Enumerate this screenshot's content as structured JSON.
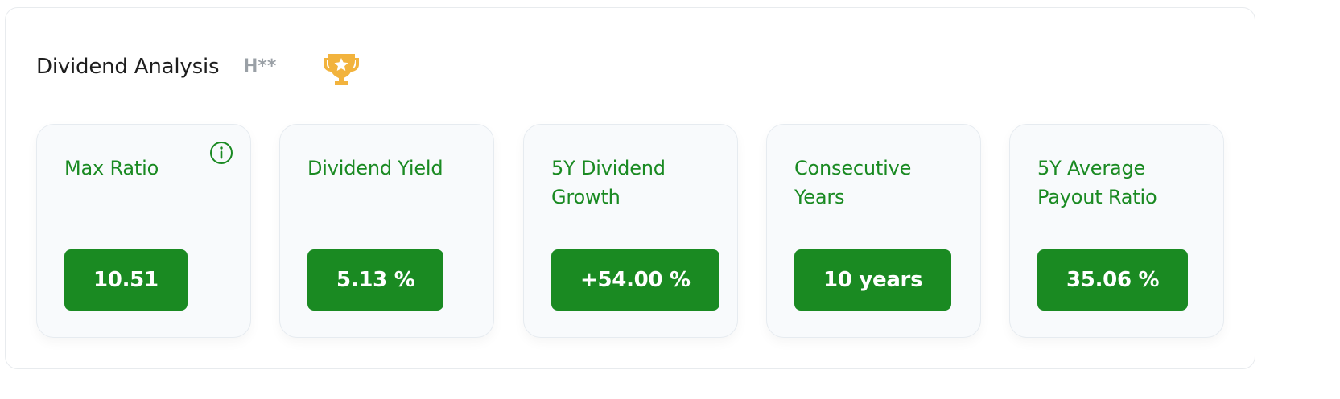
{
  "header": {
    "title": "Dividend Analysis",
    "ticker": "H**",
    "icon": "trophy-icon"
  },
  "cards": [
    {
      "label": "Max Ratio",
      "value": "10.51",
      "info_icon": "info-icon"
    },
    {
      "label": "Dividend Yield",
      "value": "5.13 %"
    },
    {
      "label": "5Y Dividend Growth",
      "value": "+54.00 %"
    },
    {
      "label": "Consecutive Years",
      "value": "10 years"
    },
    {
      "label": "5Y Average Payout Ratio",
      "value": "35.06 %"
    }
  ],
  "colors": {
    "accent": "#1a8a22",
    "trophy": "#f2b33d",
    "title": "#1e1e1e",
    "muted": "#9aa0a6",
    "card_bg": "#f8fafc"
  }
}
